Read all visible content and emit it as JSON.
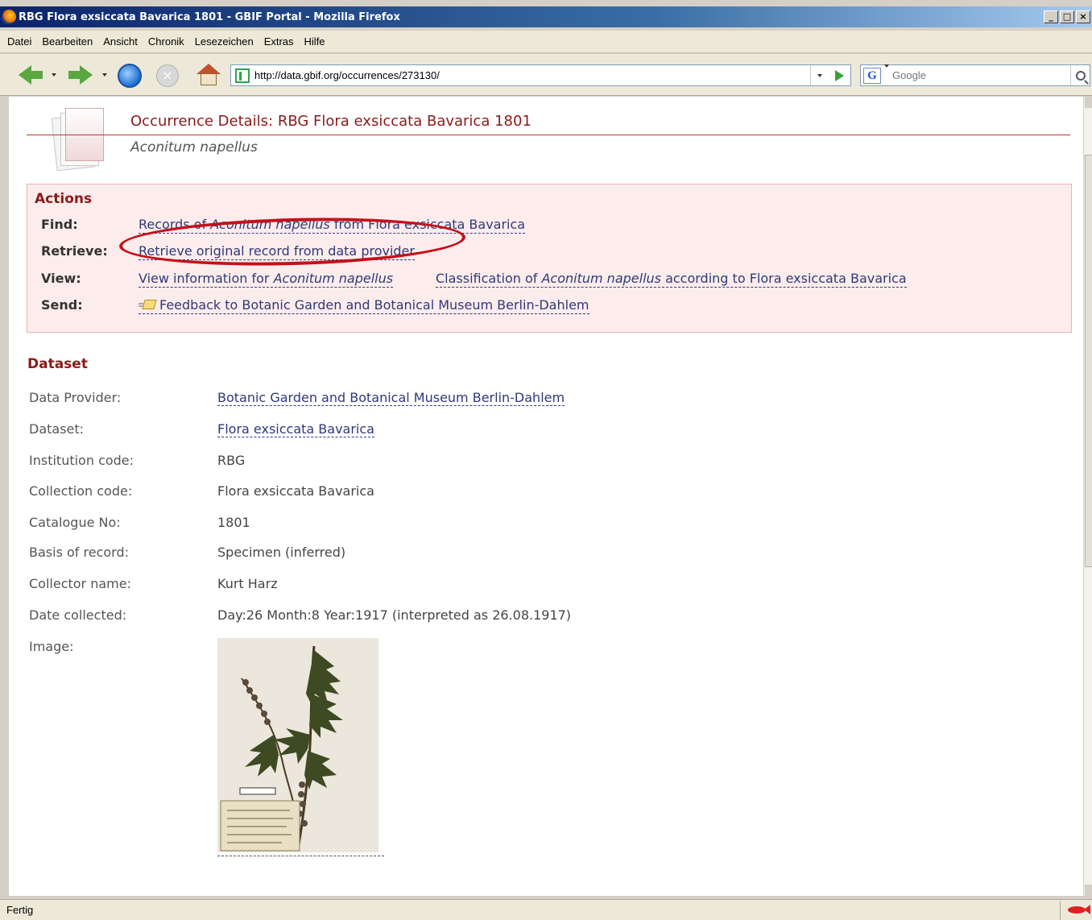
{
  "window": {
    "title": "RBG Flora exsiccata Bavarica 1801 - GBIF Portal - Mozilla Firefox",
    "minimize": "_",
    "maximize": "□",
    "close": "×"
  },
  "menubar": {
    "items": [
      "Datei",
      "Bearbeiten",
      "Ansicht",
      "Chronik",
      "Lesezeichen",
      "Extras",
      "Hilfe"
    ]
  },
  "toolbar": {
    "url": "http://data.gbif.org/occurrences/273130/",
    "search_placeholder": "Google",
    "search_engine_letter": "G",
    "icons": [
      "back-icon",
      "forward-icon",
      "reload-icon",
      "stop-icon",
      "home-icon",
      "go-icon",
      "search-icon"
    ]
  },
  "header": {
    "title": "Occurrence Details: RBG Flora exsiccata Bavarica 1801",
    "subtitle": "Aconitum napellus"
  },
  "actions": {
    "heading": "Actions",
    "find": {
      "label": "Find:",
      "link_prefix": "Records of ",
      "link_species": "Aconitum napellus",
      "link_suffix": " from Flora exsiccata Bavarica"
    },
    "retrieve": {
      "label": "Retrieve:",
      "link": "Retrieve original record from data provider"
    },
    "view": {
      "label": "View:",
      "link1_prefix": "View information for ",
      "link1_species": "Aconitum napellus",
      "link2_prefix": "Classification of ",
      "link2_species": "Aconitum napellus",
      "link2_suffix": " according to Flora exsiccata Bavarica"
    },
    "send": {
      "label": "Send:",
      "link": "Feedback to Botanic Garden and Botanical Museum Berlin-Dahlem"
    }
  },
  "dataset": {
    "heading": "Dataset",
    "fields": {
      "data_provider": {
        "label": "Data Provider:",
        "value": "Botanic Garden and Botanical Museum Berlin-Dahlem"
      },
      "dataset": {
        "label": "Dataset:",
        "value": "Flora exsiccata Bavarica"
      },
      "institution_code": {
        "label": "Institution code:",
        "value": "RBG"
      },
      "collection_code": {
        "label": "Collection code:",
        "value": "Flora exsiccata Bavarica"
      },
      "catalogue_no": {
        "label": "Catalogue No:",
        "value": "1801"
      },
      "basis_of_record": {
        "label": "Basis of record:",
        "value": "Specimen (inferred)"
      },
      "collector_name": {
        "label": "Collector name:",
        "value": "Kurt Harz"
      },
      "date_collected": {
        "label": "Date collected:",
        "value": "Day:26 Month:8 Year:1917 (interpreted as 26.08.1917)"
      },
      "image": {
        "label": "Image:"
      }
    }
  },
  "statusbar": {
    "text": "Fertig"
  },
  "colors": {
    "accent": "#8b1a1a",
    "link": "#2e3a78",
    "actions_bg": "#fdecec",
    "highlight": "#c4101a"
  }
}
